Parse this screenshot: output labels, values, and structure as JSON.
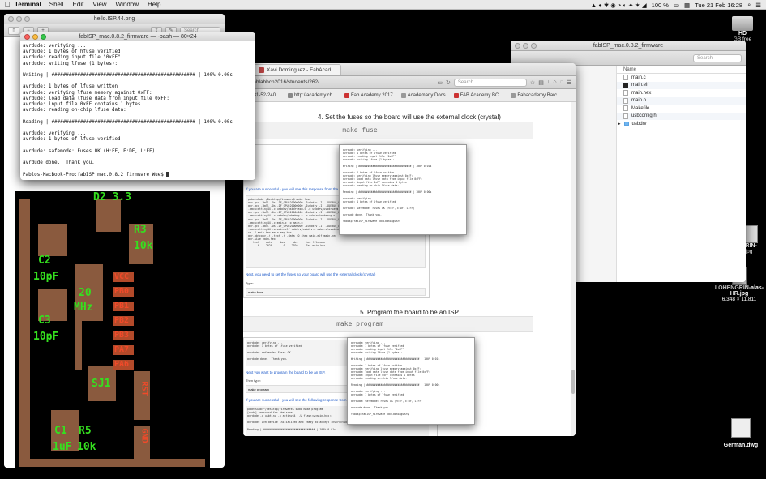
{
  "menubar": {
    "apple": "",
    "app": "Terminal",
    "items": [
      "Shell",
      "Edit",
      "View",
      "Window",
      "Help"
    ],
    "battery": "100 %",
    "clock": "Tue 21 Feb  16:28"
  },
  "desktop": {
    "hd_label": "HD",
    "hd_sub": "GB free",
    "icons": [
      {
        "label": "GRIN-",
        "sub": "jpg"
      },
      {
        "label": "LOHENGRIN-alas-HR.jpg",
        "sub": "6.348 × 11.811"
      },
      {
        "label": "German.dwg",
        "sub": ""
      }
    ]
  },
  "preview": {
    "title": "hello.ISP.44.png",
    "search_placeholder": "Search",
    "pcb_labels": [
      "D2 3.3",
      "R3",
      "10k",
      "C2",
      "10pF",
      "20",
      "MHz",
      "C3",
      "10pF",
      "SJ1",
      "C1",
      "1uF",
      "R5",
      "10k"
    ],
    "pins": [
      "VCC",
      "PB0",
      "PB1",
      "PB2",
      "PB3",
      "PA7",
      "PA6",
      "RST",
      "GND"
    ]
  },
  "terminal": {
    "title": "fabISP_mac.0.8.2_firmware — -bash — 80×24",
    "lines": [
      "avrdude: verifying ...",
      "avrdude: 1 bytes of hfuse verified",
      "avrdude: reading input file \"0xFF\"",
      "avrdude: writing lfuse (1 bytes):",
      "",
      "Writing | ################################################## | 100% 0.00s",
      "",
      "avrdude: 1 bytes of lfuse written",
      "avrdude: verifying lfuse memory against 0xFF:",
      "avrdude: load data lfuse data from input file 0xFF:",
      "avrdude: input file 0xFF contains 1 bytes",
      "avrdude: reading on-chip lfuse data:",
      "",
      "Reading | ################################################## | 100% 0.00s",
      "",
      "avrdude: verifying ...",
      "avrdude: 1 bytes of lfuse verified",
      "",
      "avrdude: safemode: Fuses OK (H:FF, E:DF, L:FF)",
      "",
      "avrdude done.  Thank you.",
      "",
      "Pablos-MacBook-Pro:fabISP_mac.0.8.2_firmware Wue$ "
    ]
  },
  "browser": {
    "tab_title": "Xavi Dominguez - FabAcad...",
    "url": "...fablabbcn2016/students/262/",
    "search_placeholder": "Search",
    "bookmarks": [
      "72-31-52-240...",
      "http://academy.cb...",
      "Fab Academy 2017",
      "Academany Docs",
      "FAB Academy BC...",
      "Fabacademy Barc..."
    ],
    "step4_heading": "4. Set the fuses so the board will use the external clock (crystal)",
    "step4_cmd": "make fuse",
    "step5_heading": "5. Program the board to be an ISP",
    "step5_cmd": "make program",
    "embedded": {
      "success_text": "If you are successful - you will see this response from the system:",
      "next_text": "Next, you need to set the fuses so your board will use the external clock (crystal)",
      "type_label": "Type:",
      "make_fuse": "make fuse",
      "program_text": "Next you want to program the board to be an ISP.",
      "then_type": "Then type:",
      "make_program": "make program",
      "success_text2": "If you are successful - you will see the following response from the system:"
    },
    "popup_lines": [
      "avrdude: verifying ...",
      "avrdude: 1 bytes of lfuse verified",
      "avrdude: reading input file \"0xFF\"",
      "avrdude: writing lfuse (1 bytes):",
      "",
      "Writing | ################################## | 100% 0.01s",
      "",
      "avrdude: 1 bytes of lfuse written",
      "avrdude: verifying lfuse memory against 0xFF:",
      "avrdude: load data lfuse data from input file 0xFF:",
      "avrdude: input file 0xFF contains 1 bytes",
      "avrdude: reading on-chip lfuse data:",
      "",
      "Reading | ################################## | 100% 0.00s",
      "",
      "avrdude: verifying ...",
      "avrdude: 1 bytes of lfuse verified",
      "",
      "avrdude: safemode: Fuses OK (H:FF, E:DF, L:FF)",
      "",
      "avrdude done.  Thank you.",
      "",
      "fabisp:fabISP_firmware xavidominguez$"
    ]
  },
  "finder": {
    "title": "fabISP_mac.0.8.2_firmware",
    "search_placeholder": "Search",
    "column_header": "Name",
    "files": [
      {
        "name": "main.c",
        "icon": "file"
      },
      {
        "name": "main.elf",
        "icon": "binary"
      },
      {
        "name": "main.hex",
        "icon": "file"
      },
      {
        "name": "main.o",
        "icon": "file"
      },
      {
        "name": "Makefile",
        "icon": "file"
      },
      {
        "name": "usbconfig.h",
        "icon": "file"
      },
      {
        "name": "usbdrv",
        "icon": "folder"
      }
    ]
  }
}
